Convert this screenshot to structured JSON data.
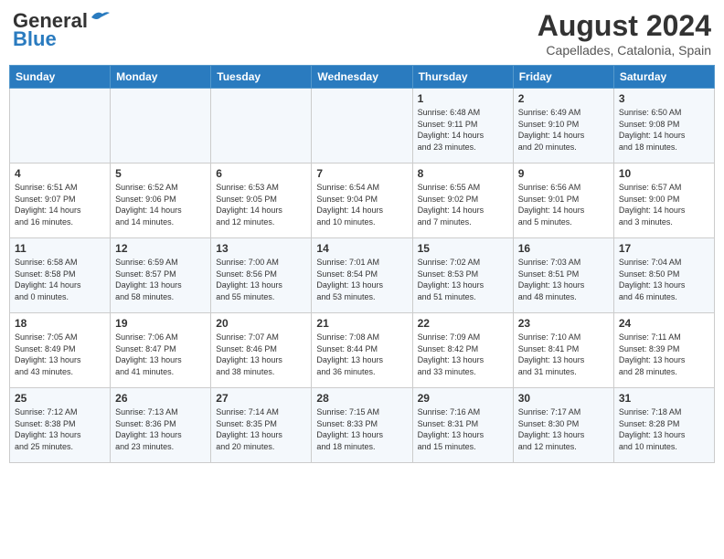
{
  "logo": {
    "general": "General",
    "blue": "Blue"
  },
  "title": "August 2024",
  "subtitle": "Capellades, Catalonia, Spain",
  "days_header": [
    "Sunday",
    "Monday",
    "Tuesday",
    "Wednesday",
    "Thursday",
    "Friday",
    "Saturday"
  ],
  "weeks": [
    [
      {
        "day": "",
        "info": ""
      },
      {
        "day": "",
        "info": ""
      },
      {
        "day": "",
        "info": ""
      },
      {
        "day": "",
        "info": ""
      },
      {
        "day": "1",
        "info": "Sunrise: 6:48 AM\nSunset: 9:11 PM\nDaylight: 14 hours\nand 23 minutes."
      },
      {
        "day": "2",
        "info": "Sunrise: 6:49 AM\nSunset: 9:10 PM\nDaylight: 14 hours\nand 20 minutes."
      },
      {
        "day": "3",
        "info": "Sunrise: 6:50 AM\nSunset: 9:08 PM\nDaylight: 14 hours\nand 18 minutes."
      }
    ],
    [
      {
        "day": "4",
        "info": "Sunrise: 6:51 AM\nSunset: 9:07 PM\nDaylight: 14 hours\nand 16 minutes."
      },
      {
        "day": "5",
        "info": "Sunrise: 6:52 AM\nSunset: 9:06 PM\nDaylight: 14 hours\nand 14 minutes."
      },
      {
        "day": "6",
        "info": "Sunrise: 6:53 AM\nSunset: 9:05 PM\nDaylight: 14 hours\nand 12 minutes."
      },
      {
        "day": "7",
        "info": "Sunrise: 6:54 AM\nSunset: 9:04 PM\nDaylight: 14 hours\nand 10 minutes."
      },
      {
        "day": "8",
        "info": "Sunrise: 6:55 AM\nSunset: 9:02 PM\nDaylight: 14 hours\nand 7 minutes."
      },
      {
        "day": "9",
        "info": "Sunrise: 6:56 AM\nSunset: 9:01 PM\nDaylight: 14 hours\nand 5 minutes."
      },
      {
        "day": "10",
        "info": "Sunrise: 6:57 AM\nSunset: 9:00 PM\nDaylight: 14 hours\nand 3 minutes."
      }
    ],
    [
      {
        "day": "11",
        "info": "Sunrise: 6:58 AM\nSunset: 8:58 PM\nDaylight: 14 hours\nand 0 minutes."
      },
      {
        "day": "12",
        "info": "Sunrise: 6:59 AM\nSunset: 8:57 PM\nDaylight: 13 hours\nand 58 minutes."
      },
      {
        "day": "13",
        "info": "Sunrise: 7:00 AM\nSunset: 8:56 PM\nDaylight: 13 hours\nand 55 minutes."
      },
      {
        "day": "14",
        "info": "Sunrise: 7:01 AM\nSunset: 8:54 PM\nDaylight: 13 hours\nand 53 minutes."
      },
      {
        "day": "15",
        "info": "Sunrise: 7:02 AM\nSunset: 8:53 PM\nDaylight: 13 hours\nand 51 minutes."
      },
      {
        "day": "16",
        "info": "Sunrise: 7:03 AM\nSunset: 8:51 PM\nDaylight: 13 hours\nand 48 minutes."
      },
      {
        "day": "17",
        "info": "Sunrise: 7:04 AM\nSunset: 8:50 PM\nDaylight: 13 hours\nand 46 minutes."
      }
    ],
    [
      {
        "day": "18",
        "info": "Sunrise: 7:05 AM\nSunset: 8:49 PM\nDaylight: 13 hours\nand 43 minutes."
      },
      {
        "day": "19",
        "info": "Sunrise: 7:06 AM\nSunset: 8:47 PM\nDaylight: 13 hours\nand 41 minutes."
      },
      {
        "day": "20",
        "info": "Sunrise: 7:07 AM\nSunset: 8:46 PM\nDaylight: 13 hours\nand 38 minutes."
      },
      {
        "day": "21",
        "info": "Sunrise: 7:08 AM\nSunset: 8:44 PM\nDaylight: 13 hours\nand 36 minutes."
      },
      {
        "day": "22",
        "info": "Sunrise: 7:09 AM\nSunset: 8:42 PM\nDaylight: 13 hours\nand 33 minutes."
      },
      {
        "day": "23",
        "info": "Sunrise: 7:10 AM\nSunset: 8:41 PM\nDaylight: 13 hours\nand 31 minutes."
      },
      {
        "day": "24",
        "info": "Sunrise: 7:11 AM\nSunset: 8:39 PM\nDaylight: 13 hours\nand 28 minutes."
      }
    ],
    [
      {
        "day": "25",
        "info": "Sunrise: 7:12 AM\nSunset: 8:38 PM\nDaylight: 13 hours\nand 25 minutes."
      },
      {
        "day": "26",
        "info": "Sunrise: 7:13 AM\nSunset: 8:36 PM\nDaylight: 13 hours\nand 23 minutes."
      },
      {
        "day": "27",
        "info": "Sunrise: 7:14 AM\nSunset: 8:35 PM\nDaylight: 13 hours\nand 20 minutes."
      },
      {
        "day": "28",
        "info": "Sunrise: 7:15 AM\nSunset: 8:33 PM\nDaylight: 13 hours\nand 18 minutes."
      },
      {
        "day": "29",
        "info": "Sunrise: 7:16 AM\nSunset: 8:31 PM\nDaylight: 13 hours\nand 15 minutes."
      },
      {
        "day": "30",
        "info": "Sunrise: 7:17 AM\nSunset: 8:30 PM\nDaylight: 13 hours\nand 12 minutes."
      },
      {
        "day": "31",
        "info": "Sunrise: 7:18 AM\nSunset: 8:28 PM\nDaylight: 13 hours\nand 10 minutes."
      }
    ]
  ]
}
